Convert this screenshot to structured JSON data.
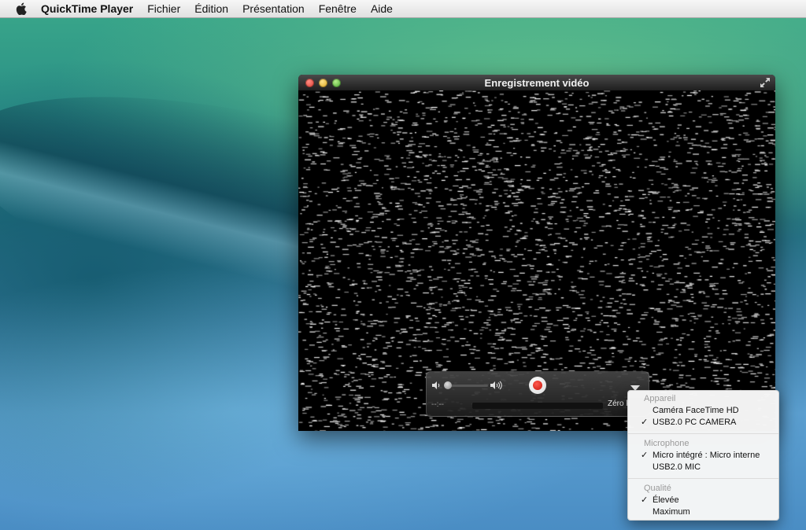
{
  "menubar": {
    "app_name": "QuickTime Player",
    "items": [
      "Fichier",
      "Édition",
      "Présentation",
      "Fenêtre",
      "Aide"
    ]
  },
  "window": {
    "title": "Enregistrement vidéo"
  },
  "hud": {
    "time": "--:--",
    "size": "Zéro k",
    "volume_level": 0.0,
    "icons": {
      "volume_low": "speaker-low-icon",
      "volume_high": "speaker-high-icon",
      "record": "record-icon",
      "options": "triangle-down-icon"
    }
  },
  "popup": {
    "sections": [
      {
        "header": "Appareil",
        "items": [
          {
            "label": "Caméra FaceTime HD",
            "checked": false
          },
          {
            "label": "USB2.0 PC CAMERA",
            "checked": true
          }
        ]
      },
      {
        "header": "Microphone",
        "items": [
          {
            "label": "Micro intégré : Micro interne",
            "checked": true
          },
          {
            "label": "USB2.0 MIC",
            "checked": false
          }
        ]
      },
      {
        "header": "Qualité",
        "items": [
          {
            "label": "Élevée",
            "checked": true
          },
          {
            "label": "Maximum",
            "checked": false
          }
        ]
      }
    ],
    "check_glyph": "✓"
  },
  "colors": {
    "record_red": "#d9281d",
    "menu_bar": "#ececec",
    "window_bg": "#000000"
  }
}
